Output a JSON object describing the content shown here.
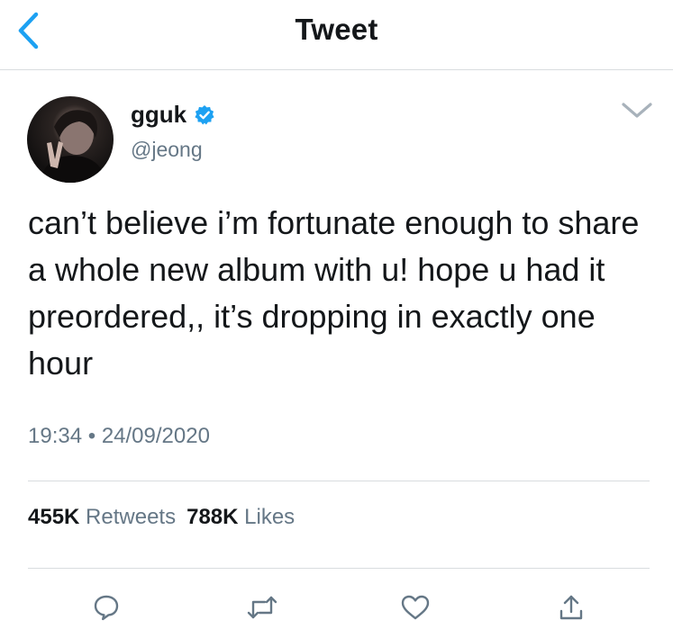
{
  "header": {
    "title": "Tweet"
  },
  "tweet": {
    "display_name": "gguk",
    "handle": "@jeong",
    "text": "can’t believe i’m fortunate enough to share a whole new album with u! hope u had it preordered,, it’s dropping in exactly one hour",
    "time": "19:34",
    "separator": "•",
    "date": "24/09/2020"
  },
  "stats": {
    "retweets_count": "455K",
    "retweets_label": "Retweets",
    "likes_count": "788K",
    "likes_label": "Likes"
  },
  "icons": {
    "back": "chevron-left-icon",
    "verified": "verified-badge-icon",
    "more": "chevron-down-icon",
    "reply": "reply-icon",
    "retweet": "retweet-icon",
    "like": "heart-icon",
    "share": "share-icon"
  },
  "colors": {
    "accent": "#1da1f2",
    "text": "#14171a",
    "muted": "#657786",
    "divider": "#d9dcdf"
  }
}
